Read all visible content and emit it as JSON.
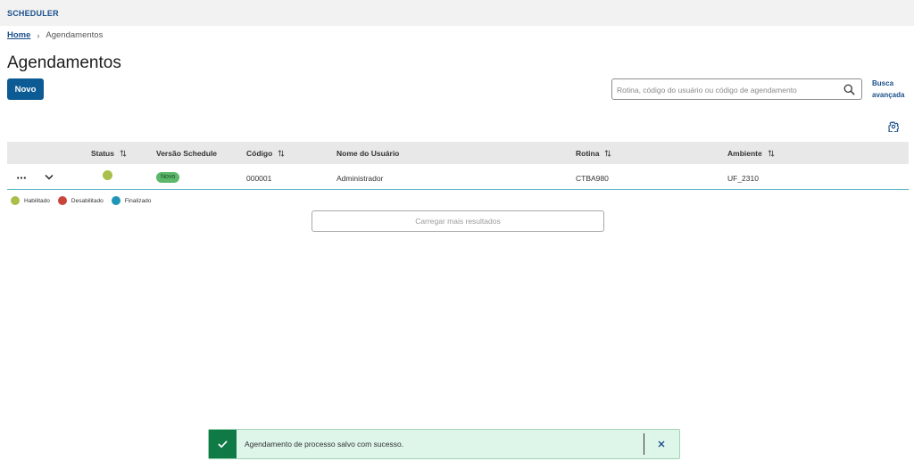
{
  "app": {
    "title": "SCHEDULER"
  },
  "breadcrumb": {
    "home": "Home",
    "separator": "›",
    "current": "Agendamentos"
  },
  "page": {
    "title": "Agendamentos"
  },
  "toolbar": {
    "new_label": "Novo",
    "search_placeholder": "Rotina, código do usuário ou código de agendamento",
    "search_value": "",
    "advanced_search_line1": "Busca",
    "advanced_search_line2": "avançada"
  },
  "table": {
    "columns": [
      "Status",
      "Versão Schedule",
      "Código",
      "Nome do Usuário",
      "Rotina",
      "Ambiente"
    ],
    "rows": [
      {
        "status_color": "#a8c04a",
        "version": "Novo",
        "version_color": "#5cb86a",
        "code": "000001",
        "user": "Administrador",
        "routine": "CTBA980",
        "environment": "UF_2310"
      }
    ]
  },
  "legend": [
    {
      "label": "Habilitado",
      "color": "#a8c04a"
    },
    {
      "label": "Desabilitado",
      "color": "#c9453b"
    },
    {
      "label": "Finalizado",
      "color": "#1f95b8"
    }
  ],
  "load_more_label": "Carregar mais resultados",
  "toast": {
    "message": "Agendamento de processo salvo com sucesso.",
    "accent": "#0f7a46"
  },
  "icons": [
    "search-icon",
    "gear-icon",
    "sort-icon",
    "more-icon",
    "chevron-down-icon",
    "check-icon",
    "close-icon"
  ]
}
